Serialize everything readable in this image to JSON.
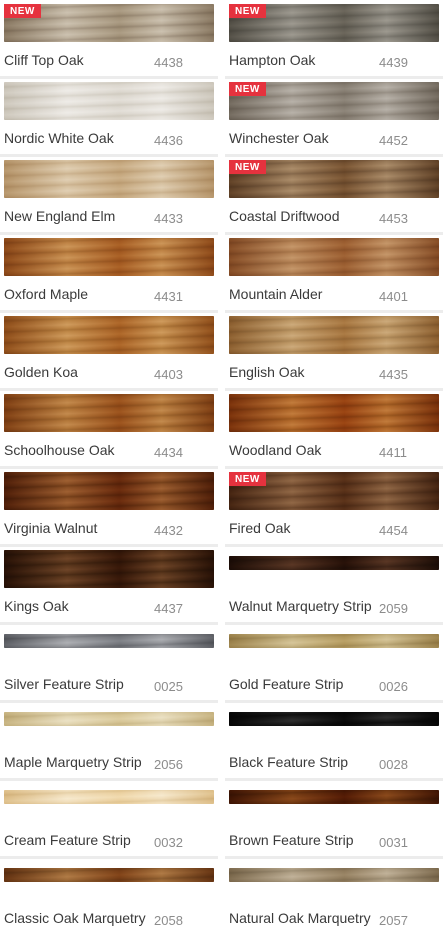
{
  "badge_label": "NEW",
  "products": [
    {
      "name": "Cliff Top Oak",
      "code": "4438",
      "is_new": true,
      "type": "plank",
      "colors": [
        "#bfb3a0",
        "#a69886",
        "#cfc5b4"
      ]
    },
    {
      "name": "Hampton Oak",
      "code": "4439",
      "is_new": true,
      "type": "plank",
      "colors": [
        "#8e8a82",
        "#7b776f",
        "#a29d94"
      ]
    },
    {
      "name": "Nordic White Oak",
      "code": "4436",
      "is_new": false,
      "type": "plank",
      "colors": [
        "#e6e3dd",
        "#d9d5cc",
        "#f0eeea"
      ]
    },
    {
      "name": "Winchester Oak",
      "code": "4452",
      "is_new": true,
      "type": "plank",
      "colors": [
        "#a9a298",
        "#968e83",
        "#bcb6ad"
      ]
    },
    {
      "name": "New England Elm",
      "code": "4433",
      "is_new": false,
      "type": "plank",
      "colors": [
        "#d8c3a3",
        "#cbb28f",
        "#e3d2b8"
      ]
    },
    {
      "name": "Coastal Driftwood",
      "code": "4453",
      "is_new": true,
      "type": "plank",
      "colors": [
        "#9a7c5b",
        "#83674a",
        "#b0926f"
      ]
    },
    {
      "name": "Oxford Maple",
      "code": "4431",
      "is_new": false,
      "type": "plank",
      "colors": [
        "#bf8447",
        "#a86f36",
        "#cf9a5e"
      ]
    },
    {
      "name": "Mountain Alder",
      "code": "4401",
      "is_new": false,
      "type": "plank",
      "colors": [
        "#b8875a",
        "#a47449",
        "#c89b6e"
      ]
    },
    {
      "name": "Golden Koa",
      "code": "4403",
      "is_new": false,
      "type": "plank",
      "colors": [
        "#c18a4a",
        "#ab7538",
        "#d29f62"
      ]
    },
    {
      "name": "English Oak",
      "code": "4435",
      "is_new": false,
      "type": "plank",
      "colors": [
        "#bf9a68",
        "#a98657",
        "#cfae80"
      ]
    },
    {
      "name": "Schoolhouse Oak",
      "code": "4434",
      "is_new": false,
      "type": "plank",
      "colors": [
        "#b57a3c",
        "#9e672e",
        "#c78f52"
      ]
    },
    {
      "name": "Woodland Oak",
      "code": "4411",
      "is_new": false,
      "type": "plank",
      "colors": [
        "#b26a2c",
        "#98571f",
        "#c58041"
      ]
    },
    {
      "name": "Virginia Walnut",
      "code": "4432",
      "is_new": false,
      "type": "plank",
      "colors": [
        "#8c5127",
        "#733f1a",
        "#a36436"
      ]
    },
    {
      "name": "Fired Oak",
      "code": "4454",
      "is_new": true,
      "type": "plank",
      "colors": [
        "#80583a",
        "#6b472c",
        "#956c4a"
      ]
    },
    {
      "name": "Kings Oak",
      "code": "4437",
      "is_new": false,
      "type": "plank",
      "colors": [
        "#5e3a1f",
        "#4a2c15",
        "#73492b"
      ]
    },
    {
      "name": "Walnut Marquetry Strip",
      "code": "2059",
      "is_new": false,
      "type": "strip",
      "colors": [
        "#4d2e1f",
        "#3e2418",
        "#5e3927"
      ]
    },
    {
      "name": "Silver Feature Strip",
      "code": "0025",
      "is_new": false,
      "type": "strip",
      "colors": [
        "#9a9ca0",
        "#7f8186",
        "#b2b4b8"
      ]
    },
    {
      "name": "Gold Feature Strip",
      "code": "0026",
      "is_new": false,
      "type": "strip",
      "colors": [
        "#c9b787",
        "#b5a272",
        "#d9c99e"
      ]
    },
    {
      "name": "Maple Marquetry Strip",
      "code": "2056",
      "is_new": false,
      "type": "strip",
      "colors": [
        "#e3d7b4",
        "#d4c69f",
        "#ede4c8"
      ]
    },
    {
      "name": "Black Feature Strip",
      "code": "0028",
      "is_new": false,
      "type": "strip",
      "colors": [
        "#1e1e1e",
        "#0f0f0f",
        "#333333"
      ]
    },
    {
      "name": "Cream Feature Strip",
      "code": "0032",
      "is_new": false,
      "type": "strip",
      "colors": [
        "#f1dfbd",
        "#e4cfa6",
        "#f8ecd2"
      ]
    },
    {
      "name": "Brown Feature Strip",
      "code": "0031",
      "is_new": false,
      "type": "strip",
      "colors": [
        "#7a3f15",
        "#65320f",
        "#8f4d1e"
      ]
    },
    {
      "name": "Classic Oak Marquetry",
      "code": "2058",
      "is_new": false,
      "type": "strip",
      "colors": [
        "#9f6c3a",
        "#875a2e",
        "#b47f4a"
      ]
    },
    {
      "name": "Natural Oak Marquetry",
      "code": "2057",
      "is_new": false,
      "type": "strip",
      "colors": [
        "#b2a389",
        "#9d8f76",
        "#c4b69e"
      ]
    }
  ]
}
